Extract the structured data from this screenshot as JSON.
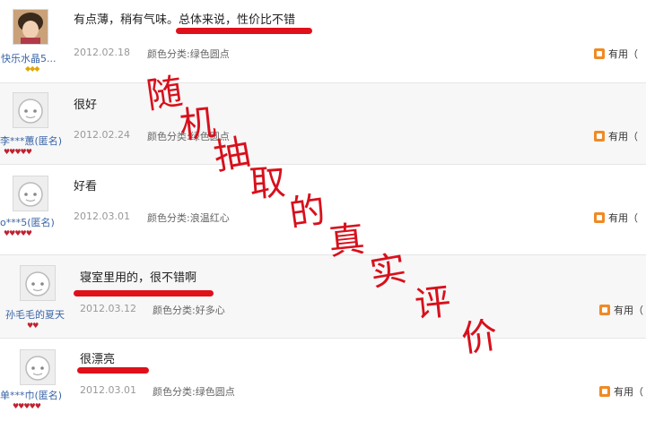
{
  "reviews": [
    {
      "username": "快乐水晶5...",
      "comment": "有点薄，稍有气味。总体来说，性价比不错",
      "date": "2012.02.18",
      "variant": "颜色分类:绿色圆点",
      "helpful": "有用（",
      "badges": "◆◆◆"
    },
    {
      "username": "李***蕙(匿名)",
      "comment": "很好",
      "date": "2012.02.24",
      "variant": "颜色分类:绿色圆点",
      "helpful": "有用（",
      "badges": "♥♥♥♥♥"
    },
    {
      "username": "o***5(匿名)",
      "comment": "好看",
      "date": "2012.03.01",
      "variant": "颜色分类:浪温红心",
      "helpful": "有用（",
      "badges": "♥♥♥♥♥"
    },
    {
      "username": "孙毛毛的夏天",
      "comment": "寝室里用的，很不错啊",
      "date": "2012.03.12",
      "variant": "颜色分类:好多心",
      "helpful": "有用（",
      "badges": "♥♥"
    },
    {
      "username": "单***巾(匿名)",
      "comment": "很漂亮",
      "date": "2012.03.01",
      "variant": "颜色分类:绿色圆点",
      "helpful": "有用（",
      "badges": "♥♥♥♥♥"
    }
  ],
  "watermark": [
    "随",
    "机",
    "抽",
    "取",
    "的",
    "真",
    "实",
    "评",
    "价"
  ],
  "colors": {
    "accent": "#e0101a",
    "username": "#3a64a8",
    "helpful_icon": "#f08a24"
  }
}
